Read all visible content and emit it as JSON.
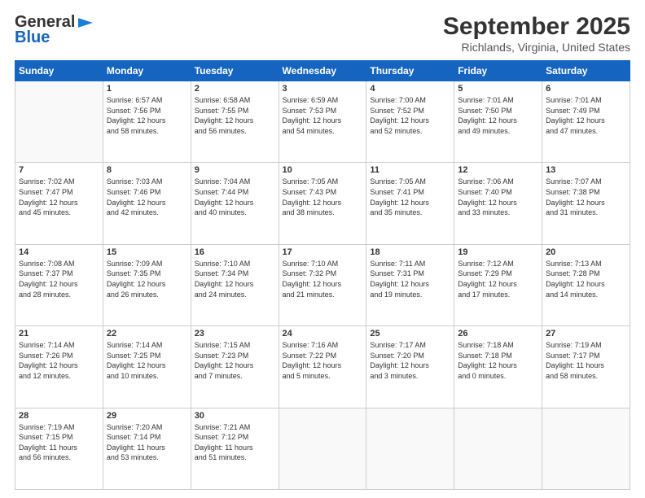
{
  "logo": {
    "general": "General",
    "blue": "Blue"
  },
  "title": "September 2025",
  "subtitle": "Richlands, Virginia, United States",
  "days_of_week": [
    "Sunday",
    "Monday",
    "Tuesday",
    "Wednesday",
    "Thursday",
    "Friday",
    "Saturday"
  ],
  "weeks": [
    [
      {
        "day": "",
        "info": ""
      },
      {
        "day": "1",
        "info": "Sunrise: 6:57 AM\nSunset: 7:56 PM\nDaylight: 12 hours\nand 58 minutes."
      },
      {
        "day": "2",
        "info": "Sunrise: 6:58 AM\nSunset: 7:55 PM\nDaylight: 12 hours\nand 56 minutes."
      },
      {
        "day": "3",
        "info": "Sunrise: 6:59 AM\nSunset: 7:53 PM\nDaylight: 12 hours\nand 54 minutes."
      },
      {
        "day": "4",
        "info": "Sunrise: 7:00 AM\nSunset: 7:52 PM\nDaylight: 12 hours\nand 52 minutes."
      },
      {
        "day": "5",
        "info": "Sunrise: 7:01 AM\nSunset: 7:50 PM\nDaylight: 12 hours\nand 49 minutes."
      },
      {
        "day": "6",
        "info": "Sunrise: 7:01 AM\nSunset: 7:49 PM\nDaylight: 12 hours\nand 47 minutes."
      }
    ],
    [
      {
        "day": "7",
        "info": "Sunrise: 7:02 AM\nSunset: 7:47 PM\nDaylight: 12 hours\nand 45 minutes."
      },
      {
        "day": "8",
        "info": "Sunrise: 7:03 AM\nSunset: 7:46 PM\nDaylight: 12 hours\nand 42 minutes."
      },
      {
        "day": "9",
        "info": "Sunrise: 7:04 AM\nSunset: 7:44 PM\nDaylight: 12 hours\nand 40 minutes."
      },
      {
        "day": "10",
        "info": "Sunrise: 7:05 AM\nSunset: 7:43 PM\nDaylight: 12 hours\nand 38 minutes."
      },
      {
        "day": "11",
        "info": "Sunrise: 7:05 AM\nSunset: 7:41 PM\nDaylight: 12 hours\nand 35 minutes."
      },
      {
        "day": "12",
        "info": "Sunrise: 7:06 AM\nSunset: 7:40 PM\nDaylight: 12 hours\nand 33 minutes."
      },
      {
        "day": "13",
        "info": "Sunrise: 7:07 AM\nSunset: 7:38 PM\nDaylight: 12 hours\nand 31 minutes."
      }
    ],
    [
      {
        "day": "14",
        "info": "Sunrise: 7:08 AM\nSunset: 7:37 PM\nDaylight: 12 hours\nand 28 minutes."
      },
      {
        "day": "15",
        "info": "Sunrise: 7:09 AM\nSunset: 7:35 PM\nDaylight: 12 hours\nand 26 minutes."
      },
      {
        "day": "16",
        "info": "Sunrise: 7:10 AM\nSunset: 7:34 PM\nDaylight: 12 hours\nand 24 minutes."
      },
      {
        "day": "17",
        "info": "Sunrise: 7:10 AM\nSunset: 7:32 PM\nDaylight: 12 hours\nand 21 minutes."
      },
      {
        "day": "18",
        "info": "Sunrise: 7:11 AM\nSunset: 7:31 PM\nDaylight: 12 hours\nand 19 minutes."
      },
      {
        "day": "19",
        "info": "Sunrise: 7:12 AM\nSunset: 7:29 PM\nDaylight: 12 hours\nand 17 minutes."
      },
      {
        "day": "20",
        "info": "Sunrise: 7:13 AM\nSunset: 7:28 PM\nDaylight: 12 hours\nand 14 minutes."
      }
    ],
    [
      {
        "day": "21",
        "info": "Sunrise: 7:14 AM\nSunset: 7:26 PM\nDaylight: 12 hours\nand 12 minutes."
      },
      {
        "day": "22",
        "info": "Sunrise: 7:14 AM\nSunset: 7:25 PM\nDaylight: 12 hours\nand 10 minutes."
      },
      {
        "day": "23",
        "info": "Sunrise: 7:15 AM\nSunset: 7:23 PM\nDaylight: 12 hours\nand 7 minutes."
      },
      {
        "day": "24",
        "info": "Sunrise: 7:16 AM\nSunset: 7:22 PM\nDaylight: 12 hours\nand 5 minutes."
      },
      {
        "day": "25",
        "info": "Sunrise: 7:17 AM\nSunset: 7:20 PM\nDaylight: 12 hours\nand 3 minutes."
      },
      {
        "day": "26",
        "info": "Sunrise: 7:18 AM\nSunset: 7:18 PM\nDaylight: 12 hours\nand 0 minutes."
      },
      {
        "day": "27",
        "info": "Sunrise: 7:19 AM\nSunset: 7:17 PM\nDaylight: 11 hours\nand 58 minutes."
      }
    ],
    [
      {
        "day": "28",
        "info": "Sunrise: 7:19 AM\nSunset: 7:15 PM\nDaylight: 11 hours\nand 56 minutes."
      },
      {
        "day": "29",
        "info": "Sunrise: 7:20 AM\nSunset: 7:14 PM\nDaylight: 11 hours\nand 53 minutes."
      },
      {
        "day": "30",
        "info": "Sunrise: 7:21 AM\nSunset: 7:12 PM\nDaylight: 11 hours\nand 51 minutes."
      },
      {
        "day": "",
        "info": ""
      },
      {
        "day": "",
        "info": ""
      },
      {
        "day": "",
        "info": ""
      },
      {
        "day": "",
        "info": ""
      }
    ]
  ]
}
